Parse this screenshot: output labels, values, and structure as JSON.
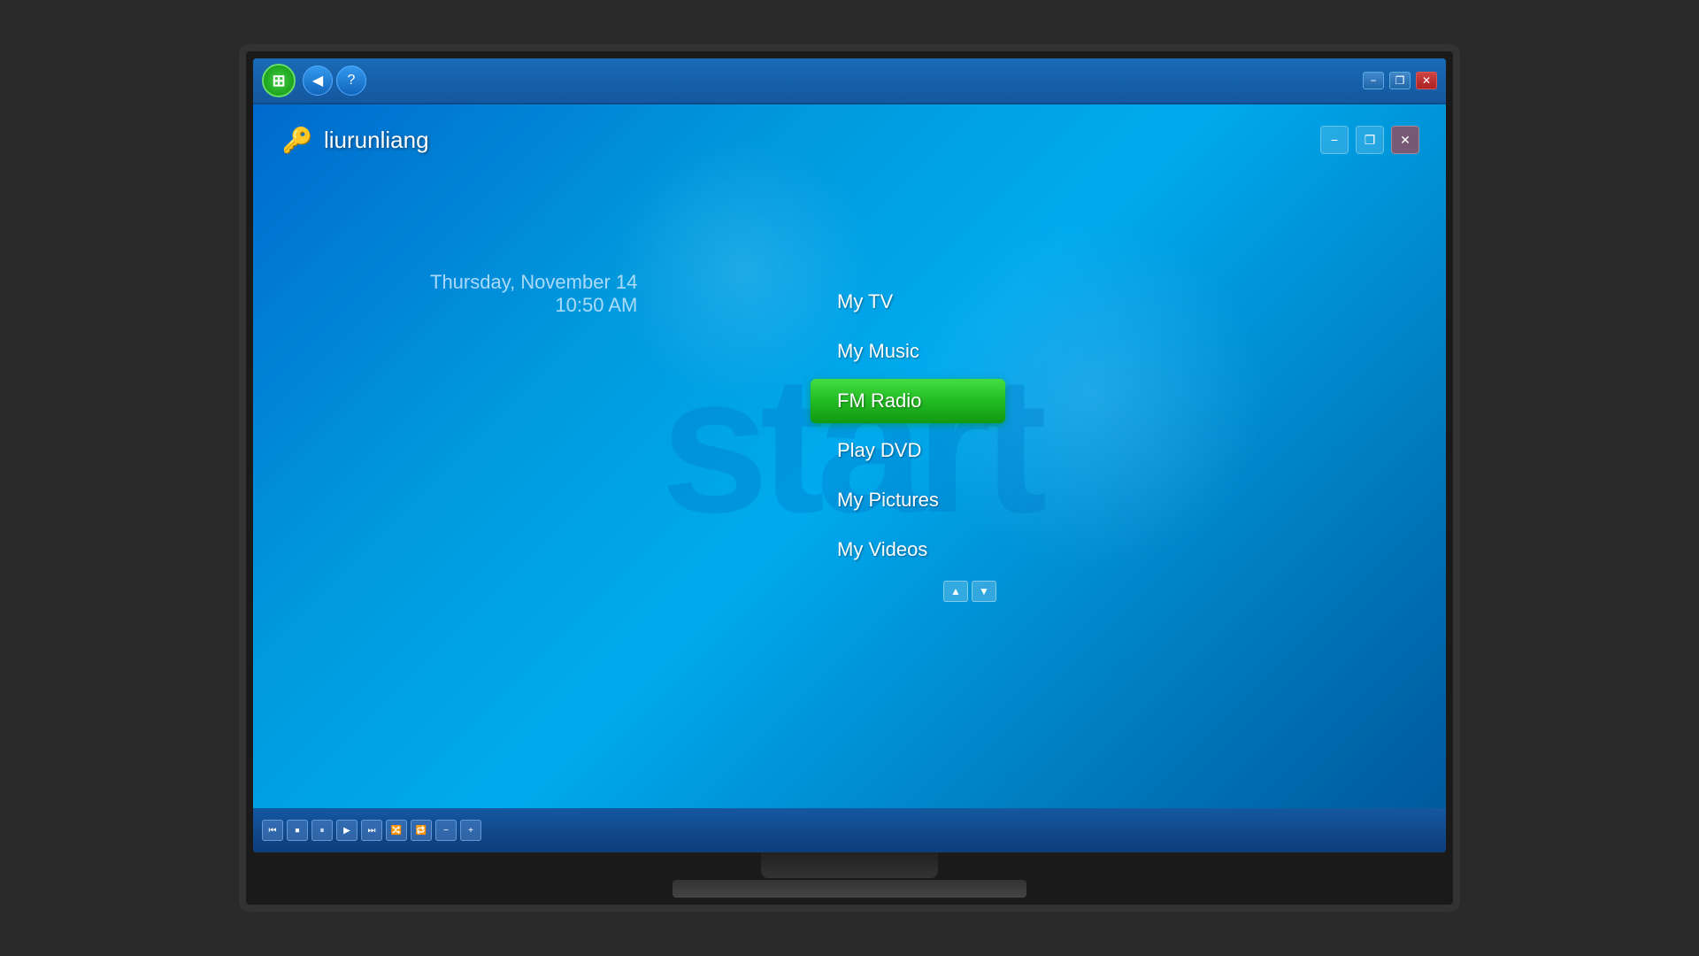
{
  "monitor": {
    "taskbar": {
      "logo_symbol": "⊞",
      "back_symbol": "◀",
      "help_symbol": "?",
      "minimize_label": "−",
      "restore_label": "❐",
      "close_label": "✕"
    },
    "header": {
      "username": "liurunliang",
      "user_icon": "🔑",
      "minimize_label": "−",
      "restore_label": "❐",
      "close_label": "✕"
    },
    "background_text": "start",
    "datetime": {
      "date": "Thursday, November 14",
      "time": "10:50 AM"
    },
    "menu": {
      "items": [
        {
          "id": "my-tv",
          "label": "My TV",
          "active": false
        },
        {
          "id": "my-music",
          "label": "My Music",
          "active": false
        },
        {
          "id": "fm-radio",
          "label": "FM Radio",
          "active": true
        },
        {
          "id": "play-dvd",
          "label": "Play DVD",
          "active": false
        },
        {
          "id": "my-pictures",
          "label": "My Pictures",
          "active": false
        },
        {
          "id": "my-videos",
          "label": "My Videos",
          "active": false
        }
      ],
      "scroll_up": "▲",
      "scroll_down": "▼"
    },
    "transport": {
      "buttons": [
        "⏮",
        "⏹",
        "⏸",
        "▶",
        "⏭",
        "🔀",
        "🔁",
        "−",
        "+"
      ]
    }
  }
}
